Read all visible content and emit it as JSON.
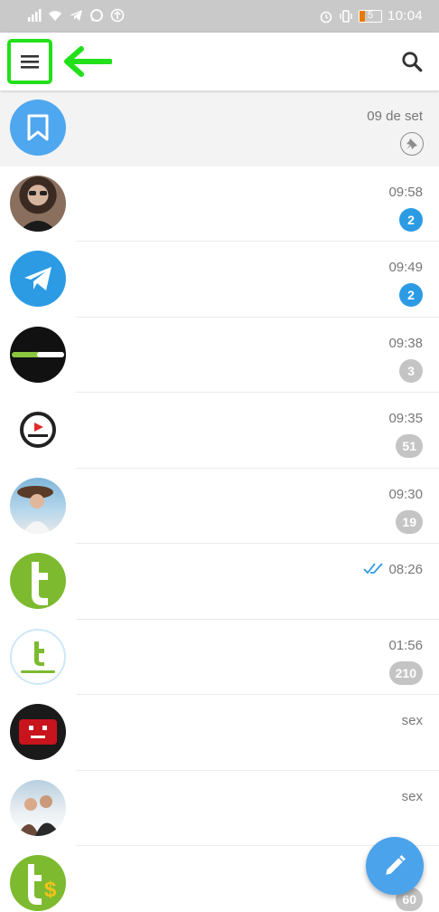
{
  "status_bar": {
    "time": "10:04",
    "battery_level": "5",
    "icons": [
      "signal-icon",
      "wifi-icon",
      "telegram-notification-icon",
      "whatsapp-notification-icon",
      "upload-icon",
      "alarm-icon",
      "vibrate-icon",
      "battery-icon"
    ]
  },
  "app_bar": {
    "icons": {
      "menu": "hamburger-menu-icon",
      "search": "search-icon"
    },
    "highlight_color": "#22e01a"
  },
  "chats": [
    {
      "time": "09 de set",
      "badge": null,
      "pinned": true,
      "avatar": "saved-messages-bookmark"
    },
    {
      "time": "09:58",
      "badge": "2",
      "badge_style": "blue",
      "avatar": "woman-with-sunglasses-photo"
    },
    {
      "time": "09:49",
      "badge": "2",
      "badge_style": "blue",
      "avatar": "telegram-logo"
    },
    {
      "time": "09:38",
      "badge": "3",
      "badge_style": "gray",
      "avatar": "tudocelular-dark-logo"
    },
    {
      "time": "09:35",
      "badge": "51",
      "badge_style": "gray",
      "avatar": "youtubers-logo"
    },
    {
      "time": "09:30",
      "badge": "19",
      "badge_style": "gray",
      "avatar": "woman-with-hat-photo"
    },
    {
      "time": "08:26",
      "badge": null,
      "read_receipt": true,
      "avatar": "green-t-logo"
    },
    {
      "time": "01:56",
      "badge": "210",
      "badge_style": "gray",
      "avatar": "tudocelular-white-logo"
    },
    {
      "time": "sex",
      "badge": null,
      "avatar": "red-sad-face-logo"
    },
    {
      "time": "sex",
      "badge": null,
      "avatar": "couple-in-snow-photo"
    },
    {
      "time": "",
      "badge": "60",
      "badge_style": "gray",
      "avatar": "green-t-dollar-logo"
    }
  ],
  "fab": {
    "icon": "pencil-icon"
  },
  "colors": {
    "accent": "#2c9be4",
    "fab": "#4aa3eb",
    "muted_badge": "#c4c4c4"
  }
}
